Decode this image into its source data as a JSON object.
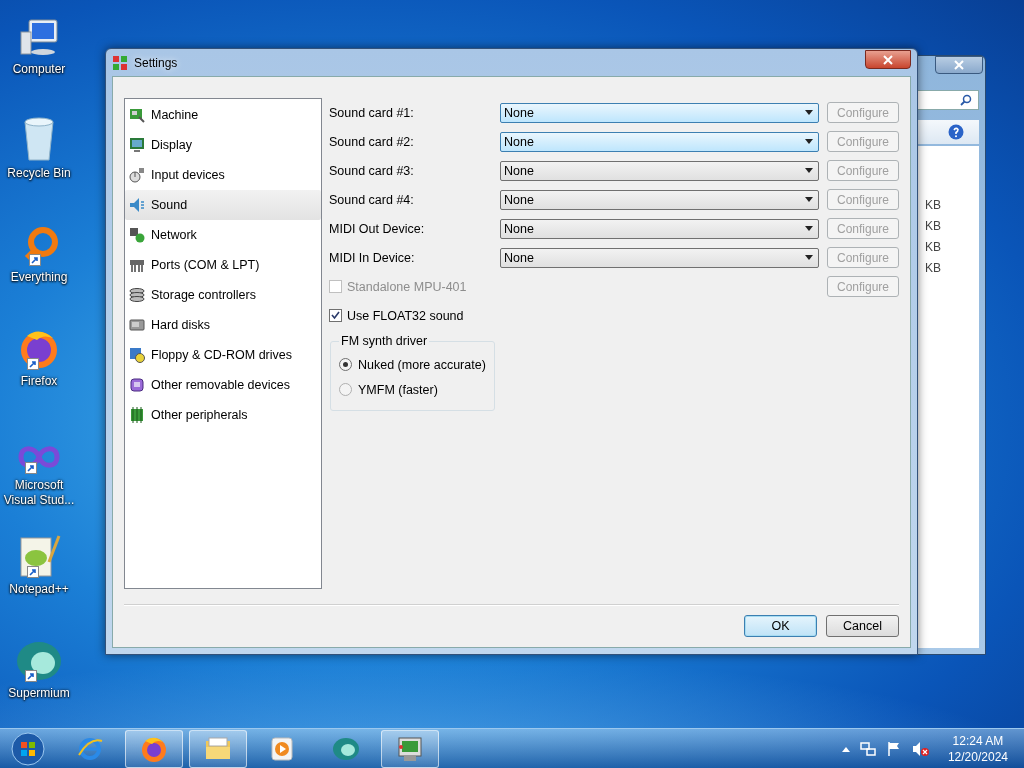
{
  "desktop_icons": [
    {
      "kind": "computer",
      "label": "Computer",
      "shortcut": false
    },
    {
      "kind": "recycle",
      "label": "Recycle Bin",
      "shortcut": false
    },
    {
      "kind": "everything",
      "label": "Everything",
      "shortcut": true
    },
    {
      "kind": "firefox",
      "label": "Firefox",
      "shortcut": true
    },
    {
      "kind": "visualstudio",
      "label": "Microsoft Visual Stud...",
      "shortcut": true
    },
    {
      "kind": "notepad",
      "label": "Notepad++",
      "shortcut": true
    },
    {
      "kind": "supermium",
      "label": "Supermium",
      "shortcut": true
    }
  ],
  "background_window": {
    "sizes": [
      "KB",
      "KB",
      "KB",
      "KB"
    ]
  },
  "dialog": {
    "title": "Settings",
    "categories": [
      {
        "kind": "machine",
        "label": "Machine",
        "selected": false
      },
      {
        "kind": "display",
        "label": "Display",
        "selected": false
      },
      {
        "kind": "input",
        "label": "Input devices",
        "selected": false
      },
      {
        "kind": "sound",
        "label": "Sound",
        "selected": true
      },
      {
        "kind": "network",
        "label": "Network",
        "selected": false
      },
      {
        "kind": "ports",
        "label": "Ports (COM & LPT)",
        "selected": false
      },
      {
        "kind": "storage",
        "label": "Storage controllers",
        "selected": false
      },
      {
        "kind": "harddisk",
        "label": "Hard disks",
        "selected": false
      },
      {
        "kind": "floppy",
        "label": "Floppy & CD-ROM drives",
        "selected": false
      },
      {
        "kind": "removable",
        "label": "Other removable devices",
        "selected": false
      },
      {
        "kind": "peripherals",
        "label": "Other peripherals",
        "selected": false
      }
    ],
    "device_rows": [
      {
        "label": "Sound card #1:",
        "value": "None",
        "highlighted": true,
        "configure": "Configure",
        "configure_disabled": true
      },
      {
        "label": "Sound card #2:",
        "value": "None",
        "highlighted": true,
        "configure": "Configure",
        "configure_disabled": true
      },
      {
        "label": "Sound card #3:",
        "value": "None",
        "highlighted": false,
        "configure": "Configure",
        "configure_disabled": true
      },
      {
        "label": "Sound card #4:",
        "value": "None",
        "highlighted": false,
        "configure": "Configure",
        "configure_disabled": true
      },
      {
        "label": "MIDI Out Device:",
        "value": "None",
        "highlighted": false,
        "configure": "Configure",
        "configure_disabled": true
      },
      {
        "label": "MIDI In Device:",
        "value": "None",
        "highlighted": false,
        "configure": "Configure",
        "configure_disabled": true
      }
    ],
    "mpu401": {
      "label": "Standalone MPU-401",
      "checked": false,
      "disabled": true,
      "configure": "Configure",
      "configure_disabled": true
    },
    "float32": {
      "label": "Use FLOAT32 sound",
      "checked": true,
      "disabled": false
    },
    "fm_synth": {
      "title": "FM synth driver",
      "options": [
        {
          "label": "Nuked (more accurate)",
          "selected": true
        },
        {
          "label": "YMFM (faster)",
          "selected": false
        }
      ]
    },
    "buttons": [
      {
        "label": "OK",
        "default": true
      },
      {
        "label": "Cancel",
        "default": false
      }
    ]
  },
  "taskbar": {
    "apps": [
      {
        "kind": "ie",
        "running": false
      },
      {
        "kind": "firefox",
        "running": true
      },
      {
        "kind": "explorer",
        "running": true
      },
      {
        "kind": "media",
        "running": false
      },
      {
        "kind": "supermium",
        "running": false
      },
      {
        "kind": "emulator",
        "running": true
      }
    ],
    "clock": {
      "time": "12:24 AM",
      "date": "12/20/2024"
    }
  }
}
